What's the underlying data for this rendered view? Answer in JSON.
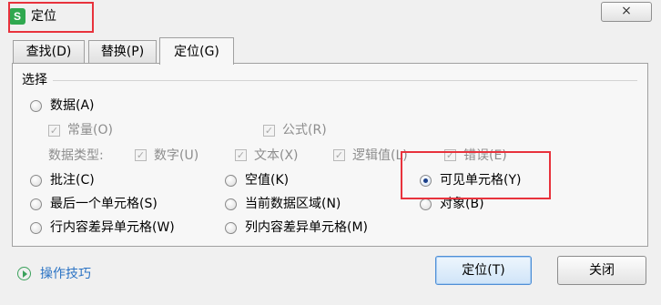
{
  "window": {
    "title": "定位",
    "app_icon_letter": "S",
    "close_glyph": "×"
  },
  "tabs": [
    {
      "label": "查找(D)",
      "active": false
    },
    {
      "label": "替换(P)",
      "active": false
    },
    {
      "label": "定位(G)",
      "active": true
    }
  ],
  "group": {
    "label": "选择",
    "options": {
      "data": {
        "label": "数据(A)",
        "checked": false
      },
      "constant": {
        "label": "常量(O)",
        "checked": true,
        "enabled": false
      },
      "formula": {
        "label": "公式(R)",
        "checked": true,
        "enabled": false
      },
      "data_type_label": "数据类型:",
      "number": {
        "label": "数字(U)",
        "checked": true,
        "enabled": false
      },
      "text": {
        "label": "文本(X)",
        "checked": true,
        "enabled": false
      },
      "logical": {
        "label": "逻辑值(L)",
        "checked": true,
        "enabled": false
      },
      "error": {
        "label": "错误(E)",
        "checked": true,
        "enabled": false
      },
      "comment": {
        "label": "批注(C)",
        "checked": false
      },
      "blank": {
        "label": "空值(K)",
        "checked": false
      },
      "visible_cells": {
        "label": "可见单元格(Y)",
        "checked": true
      },
      "last_cell": {
        "label": "最后一个单元格(S)",
        "checked": false
      },
      "current_region": {
        "label": "当前数据区域(N)",
        "checked": false
      },
      "object": {
        "label": "对象(B)",
        "checked": false
      },
      "row_diff": {
        "label": "行内容差异单元格(W)",
        "checked": false
      },
      "col_diff": {
        "label": "列内容差异单元格(M)",
        "checked": false
      }
    }
  },
  "footer": {
    "tips_label": "操作技巧",
    "locate_button": "定位(T)",
    "close_button": "关闭"
  },
  "colors": {
    "highlight": "#e8323c",
    "app_icon": "#2fa84f",
    "link": "#2b73c4"
  }
}
